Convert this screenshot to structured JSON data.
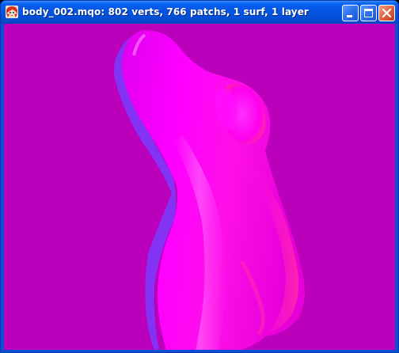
{
  "window": {
    "title": "body_002.mqo: 802 verts, 766 patchs, 1 surf, 1 layer",
    "icon": "app-character-icon",
    "buttons": {
      "minimize": "minimize-icon",
      "maximize": "maximize-icon",
      "close": "close-icon"
    }
  },
  "viewport": {
    "background_color": "#bb00bb",
    "model_colors": [
      "#ff00ff",
      "#ff30c8",
      "#7a3cff"
    ]
  }
}
